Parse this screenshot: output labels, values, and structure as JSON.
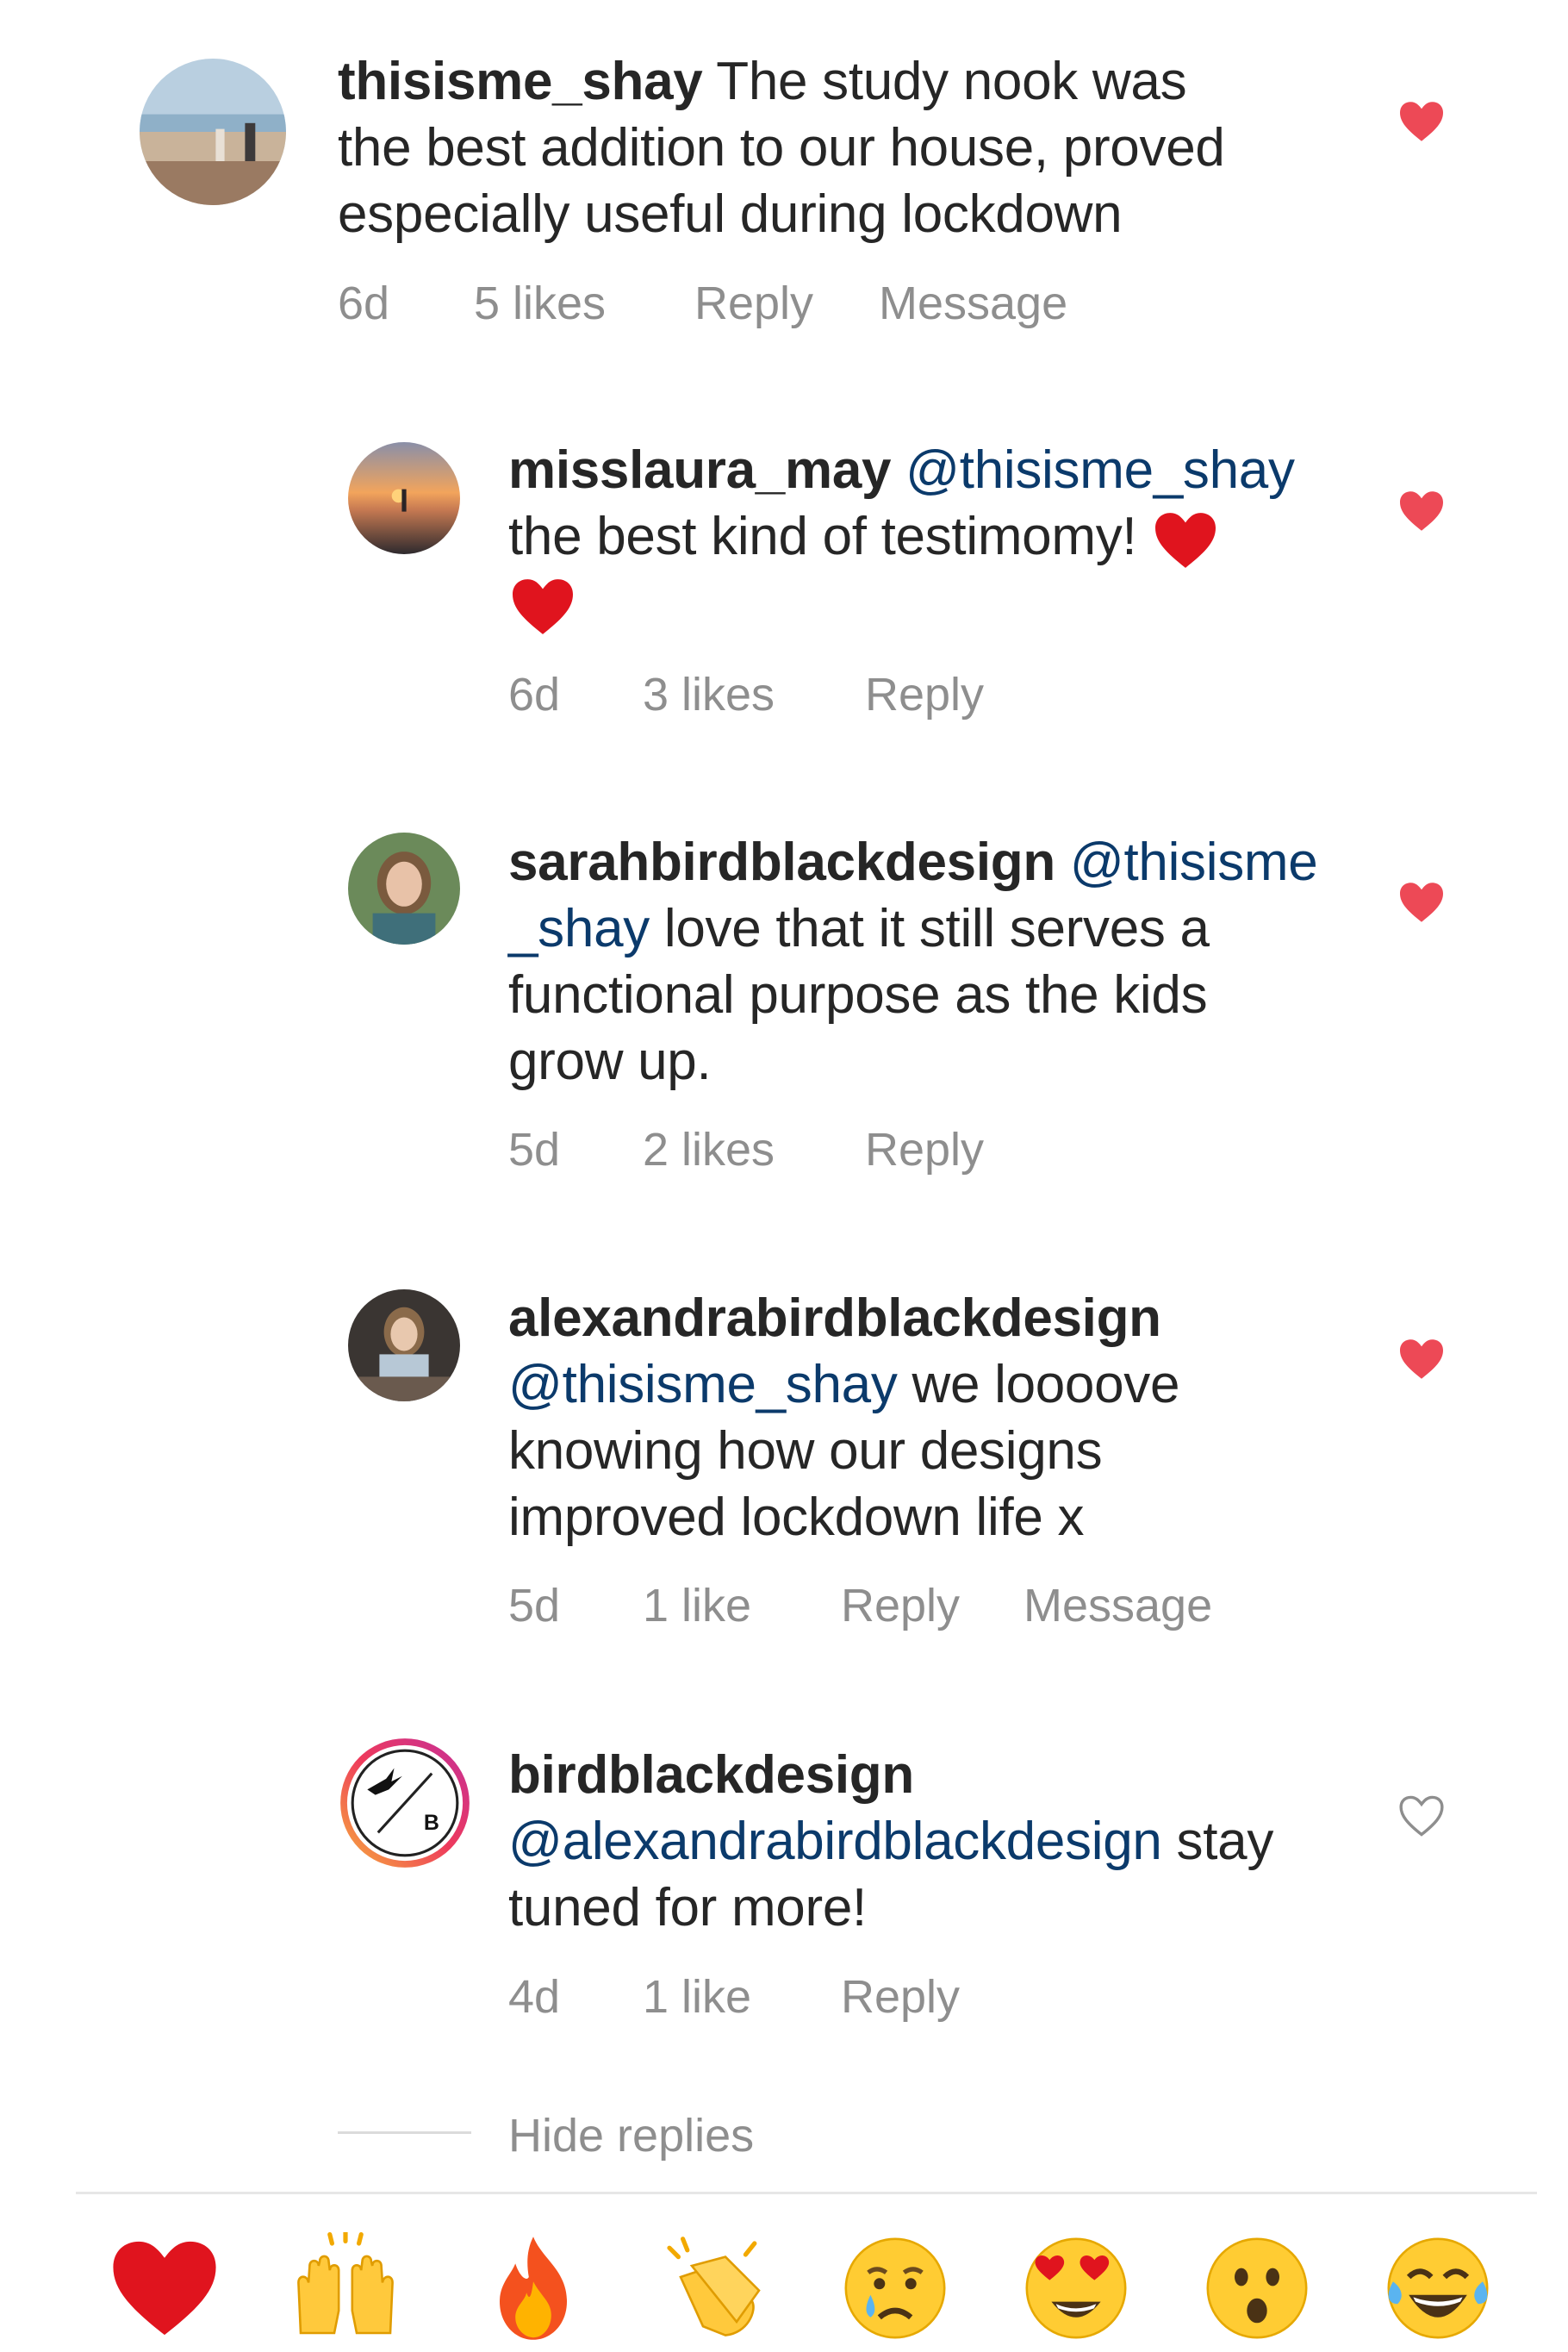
{
  "comments": [
    {
      "username": "thisisme_shay",
      "text": "The study nook was the best addition to our house, proved especially useful during lockdown",
      "line1": "The study nook was",
      "line2": "the best addition to our house, proved",
      "line3": "especially useful during lockdown",
      "time": "6d",
      "likes": "5 likes",
      "reply": "Reply",
      "message": "Message",
      "liked": true
    },
    {
      "username": "misslaura_may",
      "mention": "@thisisme_shay",
      "line2": "the best kind of testimomy!",
      "time": "6d",
      "likes": "3 likes",
      "reply": "Reply",
      "liked": true
    },
    {
      "username": "sarahbirdblackdesign",
      "mention_a": "@thisisme",
      "mention_b": "_shay",
      "line2": "love that it still serves a",
      "line3": "functional purpose as the kids",
      "line4": "grow up.",
      "time": "5d",
      "likes": "2 likes",
      "reply": "Reply",
      "liked": true
    },
    {
      "username": "alexandrabirdblackdesign",
      "mention": "@thisisme_shay",
      "line2": "we loooove",
      "line3": "knowing how our designs",
      "line4": "improved lockdown life x",
      "time": "5d",
      "likes": "1 like",
      "reply": "Reply",
      "message": "Message",
      "liked": true
    },
    {
      "username": "birdblackdesign",
      "mention": "@alexandrabirdblackdesign",
      "line2": "stay",
      "line3": "tuned for more!",
      "time": "4d",
      "likes": "1 like",
      "reply": "Reply",
      "liked": false,
      "avatar_letter": "B"
    }
  ],
  "hide_replies": "Hide replies",
  "quick_reactions": [
    "red-heart",
    "raised-hands",
    "fire",
    "clapping-hands",
    "crying-face",
    "heart-eyes-face",
    "surprised-face",
    "tears-of-joy-face"
  ],
  "colors": {
    "liked_heart": "#ed4956",
    "mention": "#0b3a6b",
    "meta": "#8e8e8e",
    "text": "#262626"
  }
}
